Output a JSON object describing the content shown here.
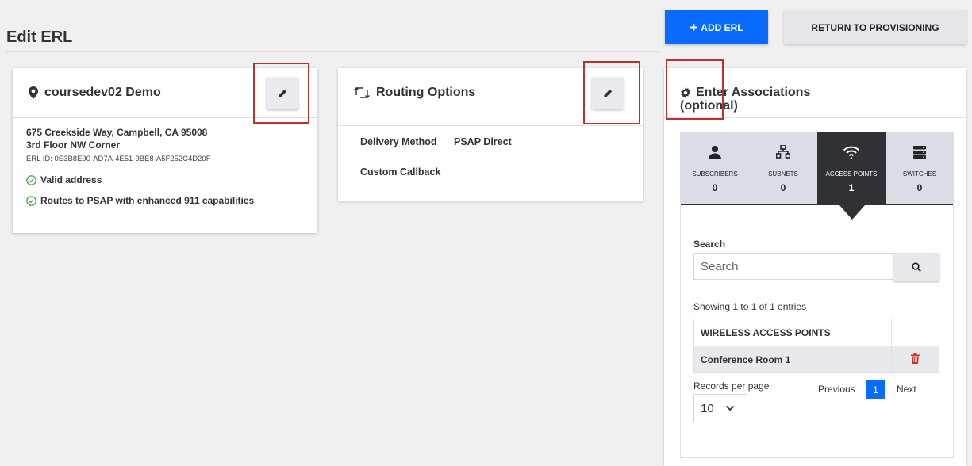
{
  "header": {
    "title": "Edit ERL",
    "add_button": "ADD ERL",
    "return_button": "RETURN TO PROVISIONING"
  },
  "location_card": {
    "title": "coursedev02 Demo",
    "address_line1": "675 Creekside Way, Campbell, CA 95008",
    "address_line2": "3rd Floor NW Corner",
    "erl_id": "ERL ID: 0E3B8E90-AD7A-4E51-9BE8-A5F252C4D20F",
    "status1": "Valid address",
    "status2": "Routes to PSAP with enhanced 911 capabilities"
  },
  "routing_card": {
    "title": "Routing Options",
    "delivery_label": "Delivery Method",
    "delivery_value": "PSAP Direct",
    "callback_label": "Custom Callback"
  },
  "associations": {
    "title_line1": "Enter Associations",
    "title_line2": "(optional)",
    "tabs": [
      {
        "label": "SUBSCRIBERS",
        "count": "0",
        "icon": "person-icon"
      },
      {
        "label": "SUBNETS",
        "count": "0",
        "icon": "network-icon"
      },
      {
        "label": "ACCESS POINTS",
        "count": "1",
        "icon": "wifi-icon"
      },
      {
        "label": "SWITCHES",
        "count": "0",
        "icon": "server-icon"
      }
    ],
    "search_label": "Search",
    "search_placeholder": "Search",
    "showing_text": "Showing 1 to 1 of 1 entries",
    "table_header": "WIRELESS ACCESS POINTS",
    "rows": [
      {
        "name": "Conference Room 1"
      }
    ],
    "records_per_page_label": "Records per page",
    "records_per_page_value": "10",
    "pagination": {
      "previous": "Previous",
      "current": "1",
      "next": "Next"
    }
  },
  "colors": {
    "accent_blue": "#0a6cff",
    "highlight_red": "#b8322e",
    "delete_red": "#d0312d",
    "tab_active_bg": "#2f3135"
  }
}
